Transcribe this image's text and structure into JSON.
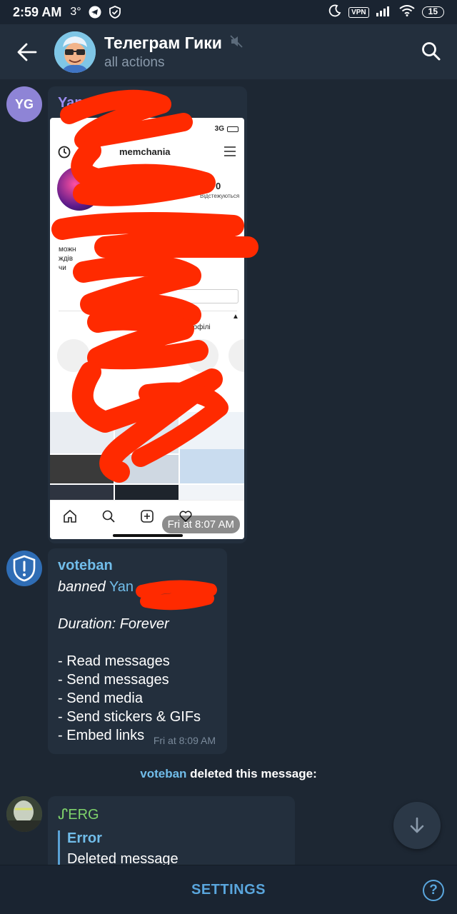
{
  "status_bar": {
    "time": "2:59 AM",
    "temperature": "3°",
    "vpn_badge": "VPN",
    "battery": "15"
  },
  "header": {
    "title": "Телеграм Гики",
    "subtitle": "all actions"
  },
  "messages": [
    {
      "avatar_initials": "YG",
      "avatar_color": "#8e84d6",
      "sender": "Yan Gu",
      "sender_color": "#9b8cf0",
      "time": "Fri at 8:07 AM",
      "screenshot": {
        "signal": "3G",
        "username": "memchania",
        "stat_value": "0",
        "stat_label": "Відстежуються",
        "bio_fragments": [
          "можн",
          "ждів",
          "чи"
        ],
        "profile_text": "рофілі"
      }
    },
    {
      "sender": "voteban",
      "sender_color": "#71bdea",
      "action": "banned",
      "target": "Yan",
      "duration": "Duration: Forever",
      "items": [
        "- Read messages",
        "- Send messages",
        "- Send media",
        "- Send stickers & GIFs",
        "- Embed links"
      ],
      "time": "Fri at 8:09 AM"
    }
  ],
  "service_message": {
    "name": "voteban",
    "text": " deleted this message:"
  },
  "last_message": {
    "sender": "ᔑERG",
    "sender_color": "#7fd36b",
    "reply_title": "Error",
    "reply_body": "Deleted message"
  },
  "bottom": {
    "settings_label": "SETTINGS",
    "help_glyph": "?"
  },
  "colors": {
    "background": "#1d2733",
    "header": "#232f3d",
    "accent": "#5aa6dd",
    "redaction": "#ff2a00"
  }
}
